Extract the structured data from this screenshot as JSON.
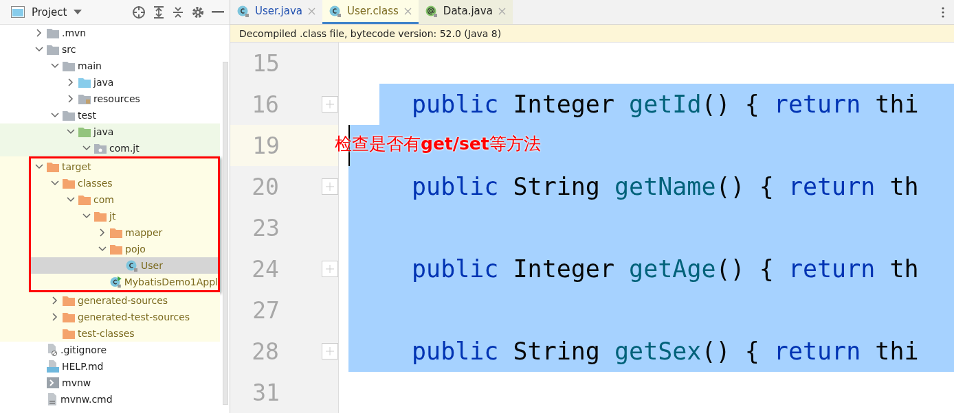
{
  "project_panel": {
    "title": "Project",
    "tree": [
      {
        "label": ".mvn",
        "kind": "folder",
        "expanded": false,
        "selected": false
      },
      {
        "label": "src",
        "kind": "folder",
        "expanded": true,
        "selected": false,
        "children": [
          {
            "label": "main",
            "kind": "folder",
            "expanded": true,
            "selected": false,
            "children": [
              {
                "label": "java",
                "kind": "source-folder",
                "expanded": false,
                "selected": false
              },
              {
                "label": "resources",
                "kind": "resources-folder",
                "expanded": false,
                "selected": false
              }
            ]
          },
          {
            "label": "test",
            "kind": "folder",
            "expanded": true,
            "selected": false,
            "children": [
              {
                "label": "java",
                "kind": "test-folder",
                "in_tests": true,
                "expanded": true,
                "selected": false,
                "children": [
                  {
                    "label": "com.jt",
                    "kind": "package",
                    "in_tests": true,
                    "expanded": true,
                    "selected": false
                  }
                ]
              }
            ]
          }
        ]
      },
      {
        "label": "target",
        "kind": "folder",
        "excluded": true,
        "outlined": true,
        "expanded": true,
        "selected": false,
        "children": [
          {
            "label": "classes",
            "kind": "folder",
            "excluded": true,
            "outlined": true,
            "expanded": true,
            "selected": false,
            "children": [
              {
                "label": "com",
                "kind": "folder",
                "excluded": true,
                "outlined": true,
                "expanded": true,
                "selected": false,
                "children": [
                  {
                    "label": "jt",
                    "kind": "folder",
                    "excluded": true,
                    "outlined": true,
                    "expanded": true,
                    "selected": false,
                    "children": [
                      {
                        "label": "mapper",
                        "kind": "folder",
                        "excluded": true,
                        "outlined": true,
                        "expanded": false,
                        "selected": false
                      },
                      {
                        "label": "pojo",
                        "kind": "folder",
                        "excluded": true,
                        "outlined": true,
                        "expanded": true,
                        "selected": false,
                        "children": [
                          {
                            "label": "User",
                            "kind": "class",
                            "excluded": true,
                            "outlined": true,
                            "selected": true
                          }
                        ]
                      },
                      {
                        "label": "MybatisDemo1Appl",
                        "kind": "app-class",
                        "excluded": true,
                        "outlined": true,
                        "selected": false
                      }
                    ]
                  }
                ]
              }
            ]
          },
          {
            "label": "generated-sources",
            "kind": "folder",
            "excluded": true,
            "expanded": false,
            "selected": false
          },
          {
            "label": "generated-test-sources",
            "kind": "folder",
            "excluded": true,
            "expanded": false,
            "selected": false
          },
          {
            "label": "test-classes",
            "kind": "folder",
            "excluded": true,
            "selected": false
          }
        ]
      },
      {
        "label": ".gitignore",
        "kind": "ignore-file",
        "selected": false
      },
      {
        "label": "HELP.md",
        "kind": "markdown-file",
        "selected": false
      },
      {
        "label": "mvnw",
        "kind": "script-file",
        "selected": false
      },
      {
        "label": "mvnw.cmd",
        "kind": "text-file",
        "selected": false
      }
    ]
  },
  "tabs": [
    {
      "label": "User.java",
      "kind": "class",
      "selected": false
    },
    {
      "label": "User.class",
      "kind": "class",
      "selected": true
    },
    {
      "label": "Data.java",
      "kind": "annotation",
      "selected": false
    }
  ],
  "banner": "Decompiled .class file, bytecode version: 52.0 (Java 8)",
  "editor": {
    "lines": [
      {
        "number": "15",
        "foldable": false,
        "selected": false,
        "caret": false
      },
      {
        "number": "16",
        "foldable": true,
        "selected": true,
        "caret": false,
        "tokens": [
          {
            "kind": "keyword",
            "text": "public"
          },
          {
            "kind": "plain",
            "text": " Integer "
          },
          {
            "kind": "method",
            "text": "getId"
          },
          {
            "kind": "plain",
            "text": "() { "
          },
          {
            "kind": "keyword",
            "text": "return"
          },
          {
            "kind": "plain",
            "text": " thi"
          }
        ]
      },
      {
        "number": "19",
        "foldable": false,
        "selected": true,
        "caret": true
      },
      {
        "number": "20",
        "foldable": true,
        "selected": true,
        "caret": false,
        "tokens": [
          {
            "kind": "keyword",
            "text": "public"
          },
          {
            "kind": "plain",
            "text": " String "
          },
          {
            "kind": "method",
            "text": "getName"
          },
          {
            "kind": "plain",
            "text": "() { "
          },
          {
            "kind": "keyword",
            "text": "return"
          },
          {
            "kind": "plain",
            "text": " th"
          }
        ]
      },
      {
        "number": "23",
        "foldable": false,
        "selected": true,
        "caret": false
      },
      {
        "number": "24",
        "foldable": true,
        "selected": true,
        "caret": false,
        "tokens": [
          {
            "kind": "keyword",
            "text": "public"
          },
          {
            "kind": "plain",
            "text": " Integer "
          },
          {
            "kind": "method",
            "text": "getAge"
          },
          {
            "kind": "plain",
            "text": "() { "
          },
          {
            "kind": "keyword",
            "text": "return"
          },
          {
            "kind": "plain",
            "text": " th"
          }
        ]
      },
      {
        "number": "27",
        "foldable": false,
        "selected": true,
        "caret": false
      },
      {
        "number": "28",
        "foldable": true,
        "selected": true,
        "caret": false,
        "tokens": [
          {
            "kind": "keyword",
            "text": "public"
          },
          {
            "kind": "plain",
            "text": " String "
          },
          {
            "kind": "method",
            "text": "getSex"
          },
          {
            "kind": "plain",
            "text": "() { "
          },
          {
            "kind": "keyword",
            "text": "return"
          },
          {
            "kind": "plain",
            "text": " thi"
          }
        ]
      },
      {
        "number": "31",
        "foldable": false,
        "selected": false,
        "caret": false
      }
    ]
  },
  "annotation": "检查是否有**get/set**等方法"
}
